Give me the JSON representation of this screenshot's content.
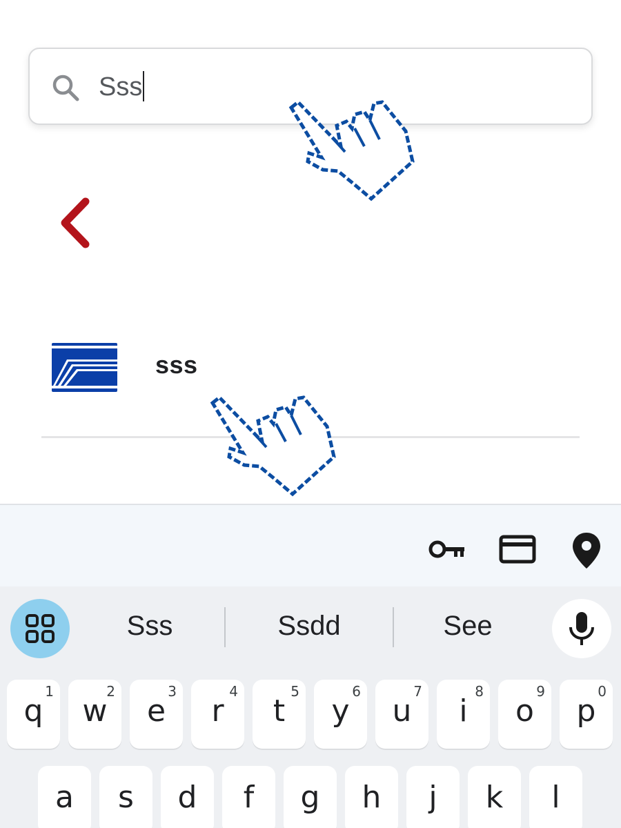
{
  "search": {
    "value": "Sss",
    "icon": "search-icon"
  },
  "back": {
    "icon": "chevron-left-icon",
    "color": "#b3141b"
  },
  "result": {
    "label": "sss",
    "logo": "sss-logo",
    "logo_color": "#0b3fa8"
  },
  "cursor_color": "#0c4da2",
  "keyboard": {
    "autofill": {
      "icons": [
        "key-icon",
        "credit-card-icon",
        "location-pin-icon"
      ]
    },
    "suggestions": [
      "Sss",
      "Ssdd",
      "See"
    ],
    "apps_icon": "grid-icon",
    "mic_icon": "microphone-icon",
    "accent": "#8ecfee",
    "row1": [
      {
        "letter": "q",
        "num": "1"
      },
      {
        "letter": "w",
        "num": "2"
      },
      {
        "letter": "e",
        "num": "3"
      },
      {
        "letter": "r",
        "num": "4"
      },
      {
        "letter": "t",
        "num": "5"
      },
      {
        "letter": "y",
        "num": "6"
      },
      {
        "letter": "u",
        "num": "7"
      },
      {
        "letter": "i",
        "num": "8"
      },
      {
        "letter": "o",
        "num": "9"
      },
      {
        "letter": "p",
        "num": "0"
      }
    ],
    "row2": [
      "a",
      "s",
      "d",
      "f",
      "g",
      "h",
      "j",
      "k",
      "l"
    ]
  }
}
